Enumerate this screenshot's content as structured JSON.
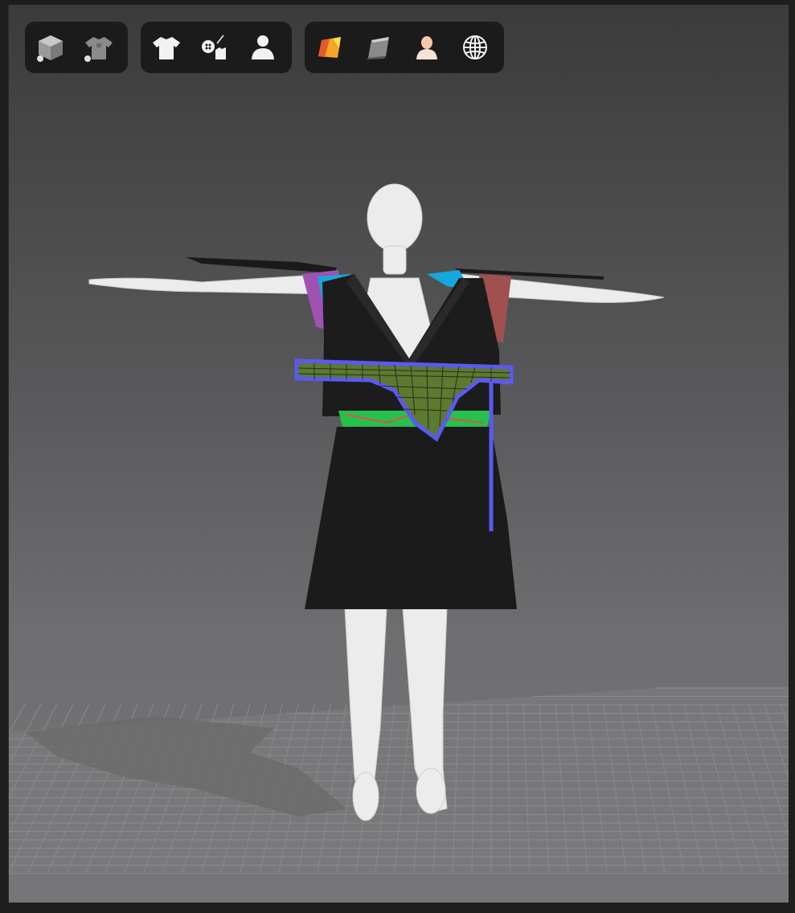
{
  "app": {
    "title": ""
  },
  "toolbars": [
    {
      "group": "display",
      "buttons": [
        {
          "icon": "avatar-display-cube-icon"
        },
        {
          "icon": "garment-display-shirt-icon"
        }
      ]
    },
    {
      "group": "visibility",
      "buttons": [
        {
          "icon": "show-garment-icon"
        },
        {
          "icon": "show-trims-button-icon"
        },
        {
          "icon": "show-avatar-icon"
        }
      ]
    },
    {
      "group": "render",
      "buttons": [
        {
          "icon": "texture-surface-icon"
        },
        {
          "icon": "thick-surface-icon"
        },
        {
          "icon": "avatar-skin-icon"
        },
        {
          "icon": "mesh-wireframe-globe-icon"
        }
      ]
    }
  ],
  "scene": {
    "background_top": "#3b3b3c",
    "background_bottom": "#767678",
    "grid_color": "#8f8f91",
    "selection_color": "#5a5af0",
    "fabric_color": "#1c1c1c"
  }
}
